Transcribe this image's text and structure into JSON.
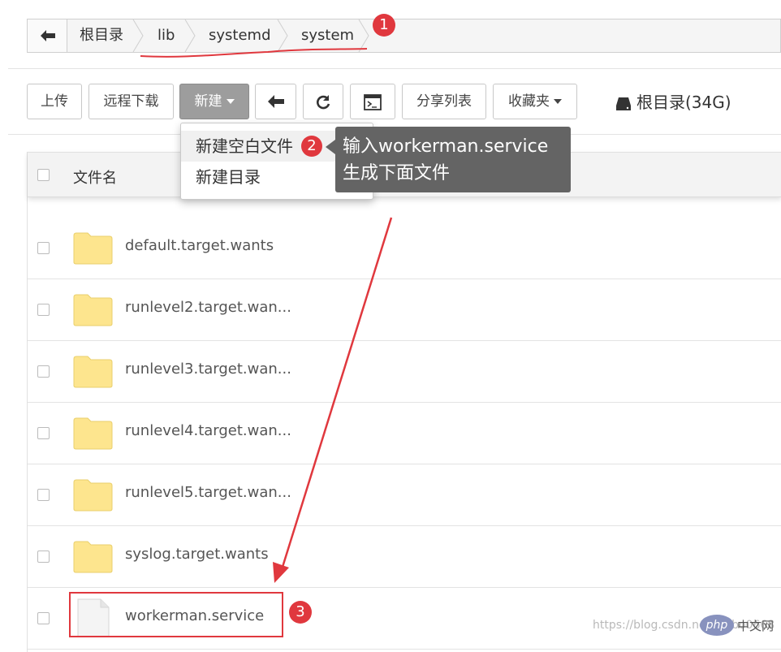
{
  "breadcrumb": {
    "items": [
      "根目录",
      "lib",
      "systemd",
      "system"
    ]
  },
  "toolbar": {
    "upload": "上传",
    "remote_download": "远程下载",
    "new": "新建",
    "share_list": "分享列表",
    "favorites": "收藏夹",
    "disk_label": "根目录(34G)"
  },
  "dropdown": {
    "items": [
      "新建空白文件",
      "新建目录"
    ]
  },
  "tooltip": {
    "line1": "输入workerman.service",
    "line2": "生成下面文件"
  },
  "table": {
    "header_name": "文件名",
    "rows": [
      {
        "name": "default.target.wants",
        "type": "folder"
      },
      {
        "name": "runlevel2.target.wan...",
        "type": "folder"
      },
      {
        "name": "runlevel3.target.wan...",
        "type": "folder"
      },
      {
        "name": "runlevel4.target.wan...",
        "type": "folder"
      },
      {
        "name": "runlevel5.target.wan...",
        "type": "folder"
      },
      {
        "name": "syslog.target.wants",
        "type": "folder"
      },
      {
        "name": "workerman.service",
        "type": "file"
      }
    ]
  },
  "annotations": {
    "badges": [
      "1",
      "2",
      "3"
    ],
    "color": "#e0383e"
  },
  "watermark": {
    "text": "https://blog.csdn.net/haibo0668",
    "logo": "php",
    "logo_text": "中文网"
  },
  "colors": {
    "active_button": "#9d9d9d",
    "folder": "#fde58e",
    "tooltip_bg": "#646464"
  }
}
